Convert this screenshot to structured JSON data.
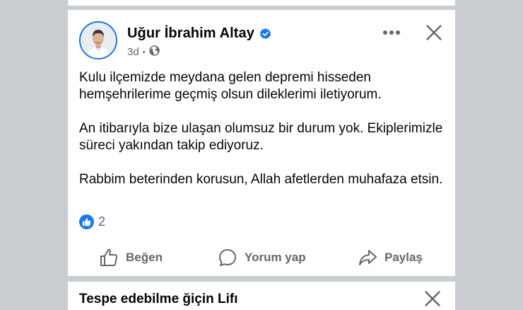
{
  "post": {
    "author": {
      "name": "Uğur İbrahim Altay",
      "verified": true
    },
    "meta": {
      "time": "3d",
      "separator": "•",
      "audience_icon": "globe-icon"
    },
    "header_icons": {
      "more": "more-options-icon",
      "close": "close-icon"
    },
    "paragraphs": [
      "Kulu ilçemizde meydana gelen depremi hisseden hemşehrilerime geçmiş olsun dileklerimi iletiyorum.",
      "An itibarıyla bize ulaşan olumsuz bir durum yok. Ekiplerimizle süreci yakından takip ediyoruz.",
      "Rabbim beterinden korusun, Allah afetlerden muhafaza etsin."
    ],
    "reactions": {
      "icon": "like-reaction-icon",
      "count": "2"
    },
    "actions": {
      "like": "Beğen",
      "comment": "Yorum yap",
      "share": "Paylaş"
    }
  },
  "next_post": {
    "title": "Tespe edebilme ğiçin Lifı"
  },
  "colors": {
    "page_background": "#c9ccd1",
    "card_background": "#ffffff",
    "accent_blue": "#1877f2",
    "primary_text": "#050505",
    "secondary_text": "#65676b"
  }
}
